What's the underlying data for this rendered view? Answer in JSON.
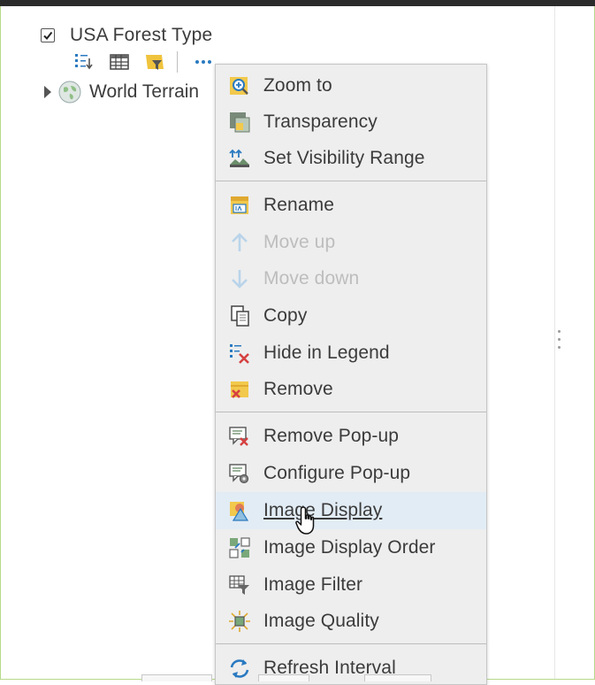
{
  "layers": [
    {
      "title": "USA Forest Type",
      "checked": true
    },
    {
      "title": "World Terrain",
      "expanded": false
    }
  ],
  "layer_tools": [
    "legend-icon",
    "table-icon",
    "filter-icon",
    "more-options-icon"
  ],
  "context_menu": {
    "items": [
      {
        "label": "Zoom to",
        "icon": "zoom-to-icon",
        "enabled": true
      },
      {
        "label": "Transparency",
        "icon": "transparency-icon",
        "enabled": true
      },
      {
        "label": "Set Visibility Range",
        "icon": "visibility-range-icon",
        "enabled": true
      },
      {
        "label": "Rename",
        "icon": "rename-icon",
        "enabled": true
      },
      {
        "label": "Move up",
        "icon": "arrow-up-icon",
        "enabled": false
      },
      {
        "label": "Move down",
        "icon": "arrow-down-icon",
        "enabled": false
      },
      {
        "label": "Copy",
        "icon": "copy-icon",
        "enabled": true
      },
      {
        "label": "Hide in Legend",
        "icon": "hide-legend-icon",
        "enabled": true
      },
      {
        "label": "Remove",
        "icon": "remove-icon",
        "enabled": true
      },
      {
        "label": "Remove Pop-up",
        "icon": "remove-popup-icon",
        "enabled": true
      },
      {
        "label": "Configure Pop-up",
        "icon": "configure-popup-icon",
        "enabled": true
      },
      {
        "label": "Image Display",
        "icon": "image-display-icon",
        "enabled": true,
        "hovered": true
      },
      {
        "label": "Image Display Order",
        "icon": "image-display-order-icon",
        "enabled": true
      },
      {
        "label": "Image Filter",
        "icon": "image-filter-icon",
        "enabled": true
      },
      {
        "label": "Image Quality",
        "icon": "image-quality-icon",
        "enabled": true
      },
      {
        "label": "Refresh Interval",
        "icon": "refresh-icon",
        "enabled": true
      }
    ]
  },
  "colors": {
    "menu_bg": "#eeeeee",
    "hover_bg": "#e2ecf5",
    "disabled_text": "#bdbdbd",
    "accent_blue": "#2a7ac0",
    "frame_green": "#b7d98a"
  }
}
